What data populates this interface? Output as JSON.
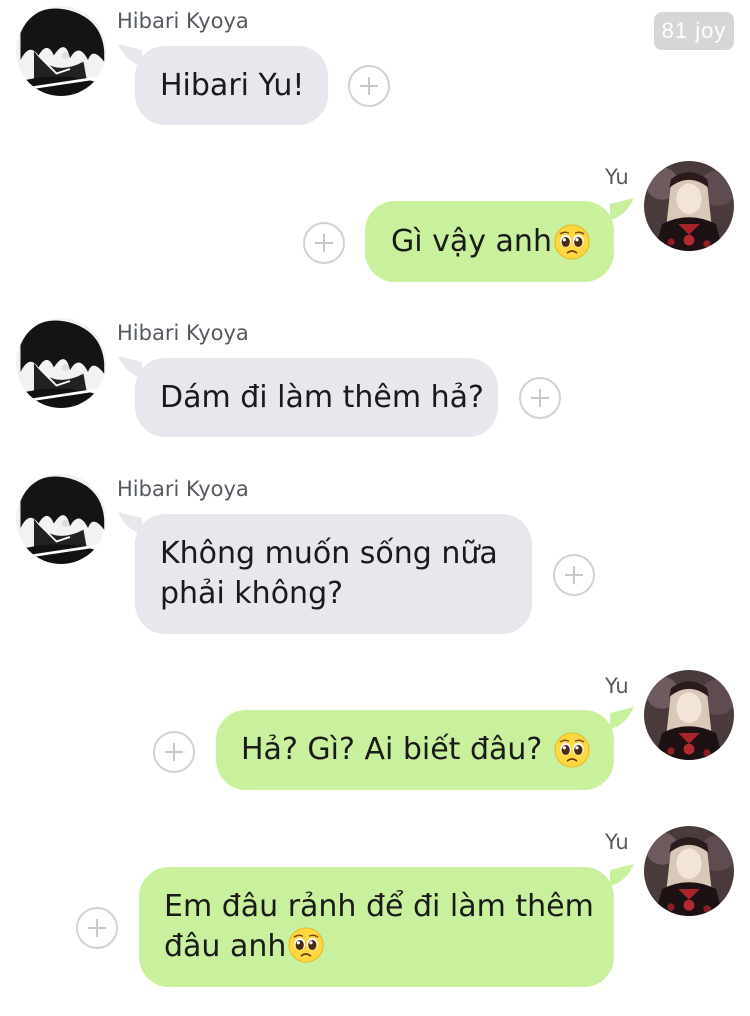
{
  "watermark": "81 joy",
  "messages": [
    {
      "direction": "incoming",
      "sender": "Hibari Kyoya",
      "text": "Hibari Yu!"
    },
    {
      "direction": "outgoing",
      "sender": "Yu",
      "text": "Gì vậy anh",
      "emoji": "pleading-face"
    },
    {
      "direction": "incoming",
      "sender": "Hibari Kyoya",
      "text": "Dám đi làm thêm hả?"
    },
    {
      "direction": "incoming",
      "sender": "Hibari Kyoya",
      "lines": [
        "Không muốn sống nữa",
        "phải không?"
      ]
    },
    {
      "direction": "outgoing",
      "sender": "Yu",
      "text": "Hả? Gì? Ai biết đâu?",
      "emoji": "pleading-face"
    },
    {
      "direction": "outgoing",
      "sender": "Yu",
      "lines": [
        "Em đâu rảnh để đi làm thêm",
        "đâu anh"
      ],
      "emoji": "pleading-face"
    }
  ],
  "colors": {
    "incoming_bubble": "#e6e8ed",
    "outgoing_bubble": "#c9f09c",
    "sender_name": "#555a60",
    "watermark_bg": "#d6d6d6"
  },
  "icons": {
    "reaction": "add-reaction-icon",
    "emoji": "pleading-face-emoji-icon",
    "avatar_incoming": "hibari-avatar",
    "avatar_outgoing": "yu-avatar"
  }
}
